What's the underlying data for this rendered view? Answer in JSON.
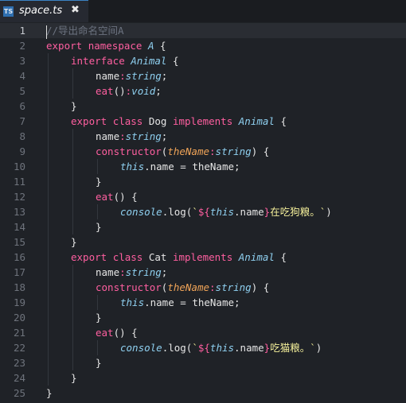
{
  "tab": {
    "icon_label": "TS",
    "title": "space.ts",
    "close_label": "✖"
  },
  "editor": {
    "active_line": 1,
    "lines": [
      {
        "n": "1",
        "indent": 0,
        "tokens": [
          [
            "cmt",
            "//导出命名空间A"
          ]
        ]
      },
      {
        "n": "2",
        "indent": 0,
        "tokens": [
          [
            "kw",
            "export"
          ],
          [
            "pn",
            " "
          ],
          [
            "kw",
            "namespace"
          ],
          [
            "pn",
            " "
          ],
          [
            "cls",
            "A"
          ],
          [
            "pn",
            " {"
          ]
        ]
      },
      {
        "n": "3",
        "indent": 1,
        "tokens": [
          [
            "kw",
            "interface"
          ],
          [
            "pn",
            " "
          ],
          [
            "cls",
            "Animal"
          ],
          [
            "pn",
            " {"
          ]
        ]
      },
      {
        "n": "4",
        "indent": 2,
        "tokens": [
          [
            "id",
            "name"
          ],
          [
            "kw",
            ":"
          ],
          [
            "type",
            "string"
          ],
          [
            "pn",
            ";"
          ]
        ]
      },
      {
        "n": "5",
        "indent": 2,
        "tokens": [
          [
            "fn",
            "eat"
          ],
          [
            "pn",
            "()"
          ],
          [
            "kw",
            ":"
          ],
          [
            "type",
            "void"
          ],
          [
            "pn",
            ";"
          ]
        ]
      },
      {
        "n": "6",
        "indent": 1,
        "tokens": [
          [
            "pn",
            "}"
          ]
        ]
      },
      {
        "n": "7",
        "indent": 1,
        "tokens": [
          [
            "kw",
            "export"
          ],
          [
            "pn",
            " "
          ],
          [
            "kw",
            "class"
          ],
          [
            "pn",
            " "
          ],
          [
            "id",
            "Dog"
          ],
          [
            "pn",
            " "
          ],
          [
            "kw",
            "implements"
          ],
          [
            "pn",
            " "
          ],
          [
            "cls",
            "Animal"
          ],
          [
            "pn",
            " {"
          ]
        ]
      },
      {
        "n": "8",
        "indent": 2,
        "tokens": [
          [
            "id",
            "name"
          ],
          [
            "kw",
            ":"
          ],
          [
            "type",
            "string"
          ],
          [
            "pn",
            ";"
          ]
        ]
      },
      {
        "n": "9",
        "indent": 2,
        "tokens": [
          [
            "kw",
            "constructor"
          ],
          [
            "pn",
            "("
          ],
          [
            "param",
            "theName"
          ],
          [
            "kw",
            ":"
          ],
          [
            "type",
            "string"
          ],
          [
            "pn",
            ") {"
          ]
        ]
      },
      {
        "n": "10",
        "indent": 3,
        "tokens": [
          [
            "this",
            "this"
          ],
          [
            "pn",
            ".name = theName;"
          ]
        ]
      },
      {
        "n": "11",
        "indent": 2,
        "tokens": [
          [
            "pn",
            "}"
          ]
        ]
      },
      {
        "n": "12",
        "indent": 2,
        "tokens": [
          [
            "fn",
            "eat"
          ],
          [
            "pn",
            "() {"
          ]
        ]
      },
      {
        "n": "13",
        "indent": 3,
        "tokens": [
          [
            "this",
            "console"
          ],
          [
            "pn",
            ".log("
          ],
          [
            "str",
            "`"
          ],
          [
            "tpl",
            "${"
          ],
          [
            "this",
            "this"
          ],
          [
            "pn",
            ".name"
          ],
          [
            "tpl",
            "}"
          ],
          [
            "str",
            "在吃狗粮。`"
          ],
          [
            "pn",
            ")"
          ]
        ]
      },
      {
        "n": "14",
        "indent": 2,
        "tokens": [
          [
            "pn",
            "}"
          ]
        ]
      },
      {
        "n": "15",
        "indent": 1,
        "tokens": [
          [
            "pn",
            "}"
          ]
        ]
      },
      {
        "n": "16",
        "indent": 1,
        "tokens": [
          [
            "kw",
            "export"
          ],
          [
            "pn",
            " "
          ],
          [
            "kw",
            "class"
          ],
          [
            "pn",
            " "
          ],
          [
            "id",
            "Cat"
          ],
          [
            "pn",
            " "
          ],
          [
            "kw",
            "implements"
          ],
          [
            "pn",
            " "
          ],
          [
            "cls",
            "Animal"
          ],
          [
            "pn",
            " {"
          ]
        ]
      },
      {
        "n": "17",
        "indent": 2,
        "tokens": [
          [
            "id",
            "name"
          ],
          [
            "kw",
            ":"
          ],
          [
            "type",
            "string"
          ],
          [
            "pn",
            ";"
          ]
        ]
      },
      {
        "n": "18",
        "indent": 2,
        "tokens": [
          [
            "kw",
            "constructor"
          ],
          [
            "pn",
            "("
          ],
          [
            "param",
            "theName"
          ],
          [
            "kw",
            ":"
          ],
          [
            "type",
            "string"
          ],
          [
            "pn",
            ") {"
          ]
        ]
      },
      {
        "n": "19",
        "indent": 3,
        "tokens": [
          [
            "this",
            "this"
          ],
          [
            "pn",
            ".name = theName;"
          ]
        ]
      },
      {
        "n": "20",
        "indent": 2,
        "tokens": [
          [
            "pn",
            "}"
          ]
        ]
      },
      {
        "n": "21",
        "indent": 2,
        "tokens": [
          [
            "fn",
            "eat"
          ],
          [
            "pn",
            "() {"
          ]
        ]
      },
      {
        "n": "22",
        "indent": 3,
        "tokens": [
          [
            "this",
            "console"
          ],
          [
            "pn",
            ".log("
          ],
          [
            "str",
            "`"
          ],
          [
            "tpl",
            "${"
          ],
          [
            "this",
            "this"
          ],
          [
            "pn",
            ".name"
          ],
          [
            "tpl",
            "}"
          ],
          [
            "str",
            "吃猫粮。`"
          ],
          [
            "pn",
            ")"
          ]
        ]
      },
      {
        "n": "23",
        "indent": 2,
        "tokens": [
          [
            "pn",
            "}"
          ]
        ]
      },
      {
        "n": "24",
        "indent": 1,
        "tokens": [
          [
            "pn",
            "}"
          ]
        ]
      },
      {
        "n": "25",
        "indent": 0,
        "tokens": [
          [
            "pn",
            "}"
          ]
        ]
      }
    ]
  },
  "colors": {
    "background": "#1f2227",
    "keyword": "#ff5fa0",
    "type": "#8fd0f0",
    "parameter": "#f0a458",
    "string": "#f4ef9a",
    "comment": "#6c7380"
  }
}
